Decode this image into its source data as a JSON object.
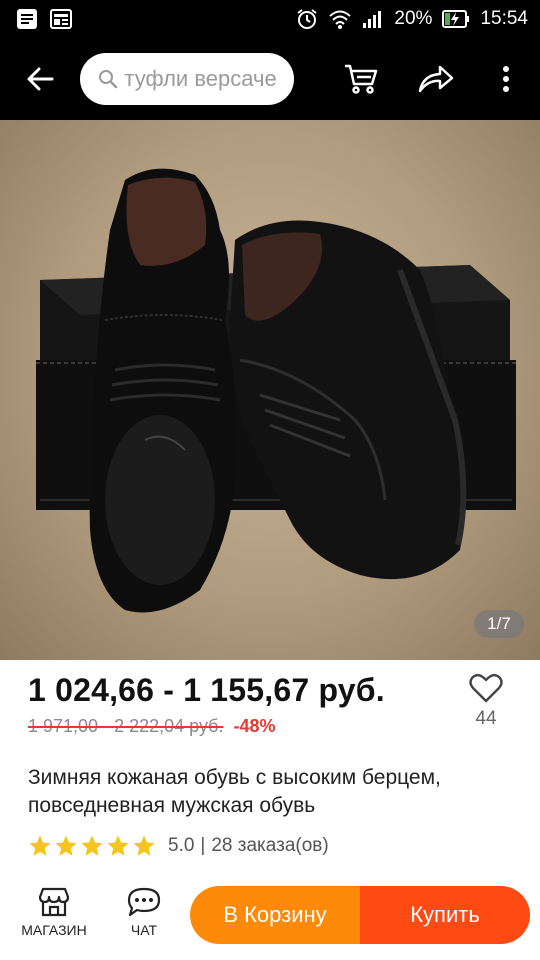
{
  "status_bar": {
    "battery": "20%",
    "time": "15:54"
  },
  "app_bar": {
    "search_text": "туфли версаче"
  },
  "gallery": {
    "pager": "1/7"
  },
  "product": {
    "price": "1 024,66 - 1 155,67 руб.",
    "old_price": "1 971,00 - 2 222,04 руб.",
    "discount": "-48%",
    "wishlist_count": "44",
    "title": "Зимняя кожаная обувь с высоким берцем, повседневная мужская обувь",
    "rating": "5.0",
    "orders": "28 заказа(ов)",
    "rating_stars": 5,
    "star_color": "#f5c518"
  },
  "bottom_bar": {
    "store_label": "МАГАЗИН",
    "chat_label": "ЧАТ",
    "cart_label": "В Корзину",
    "buy_label": "Купить",
    "cart_color": "#ff8a0a",
    "buy_color": "#ff4a14"
  }
}
